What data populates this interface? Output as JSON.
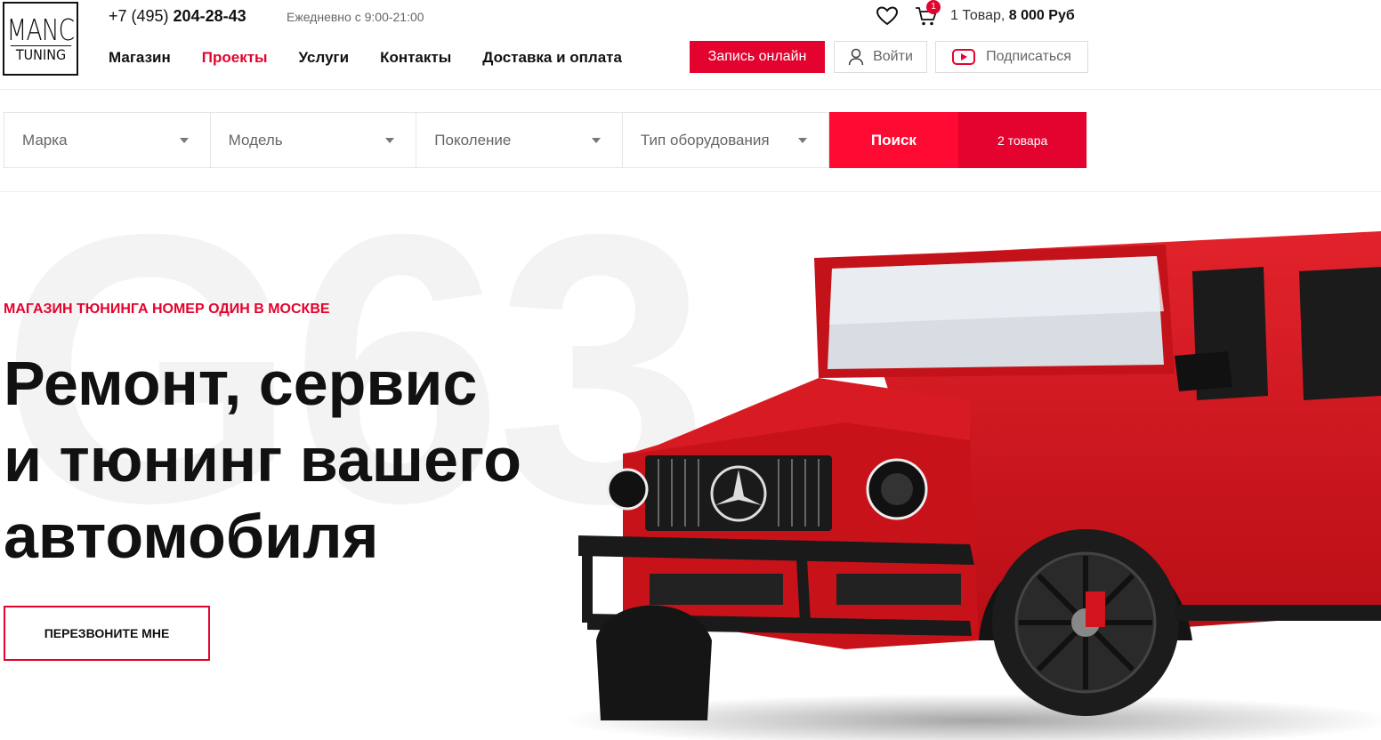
{
  "header": {
    "logo_top": "MANC",
    "logo_bottom": "TUNING",
    "phone_prefix": "+7 (495) ",
    "phone_number": "204-28-43",
    "hours": "Ежедневно с 9:00-21:00",
    "nav": [
      {
        "label": "Магазин",
        "active": false
      },
      {
        "label": "Проекты",
        "active": true
      },
      {
        "label": "Услуги",
        "active": false
      },
      {
        "label": "Контакты",
        "active": false
      },
      {
        "label": "Доставка и оплата",
        "active": false
      }
    ],
    "cart_badge": "1",
    "cart_items": "1 Товар,",
    "cart_total": "8 000 Руб",
    "book_label": "Запись онлайн",
    "login_label": "Войти",
    "subscribe_label": "Подписаться"
  },
  "filter": {
    "brand": "Марка",
    "model": "Модель",
    "generation": "Поколение",
    "equipment": "Тип оборудования",
    "search_label": "Поиск",
    "count_label": "2 товара"
  },
  "hero": {
    "bg_text": "G63",
    "kicker": "МАГАЗИН ТЮНИНГА НОМЕР ОДИН В МОСКВЕ",
    "title_line1": "Ремонт, сервис",
    "title_line2": "и тюнинг вашего",
    "title_line3": "автомобиля",
    "callback_label": "ПЕРЕЗВОНИТЕ МНЕ"
  },
  "colors": {
    "accent": "#e4032e",
    "search": "#ff0a33",
    "car_body": "#d4141c"
  },
  "icons": [
    "heart-icon",
    "cart-icon",
    "user-icon",
    "youtube-icon",
    "chevron-down-icon"
  ]
}
